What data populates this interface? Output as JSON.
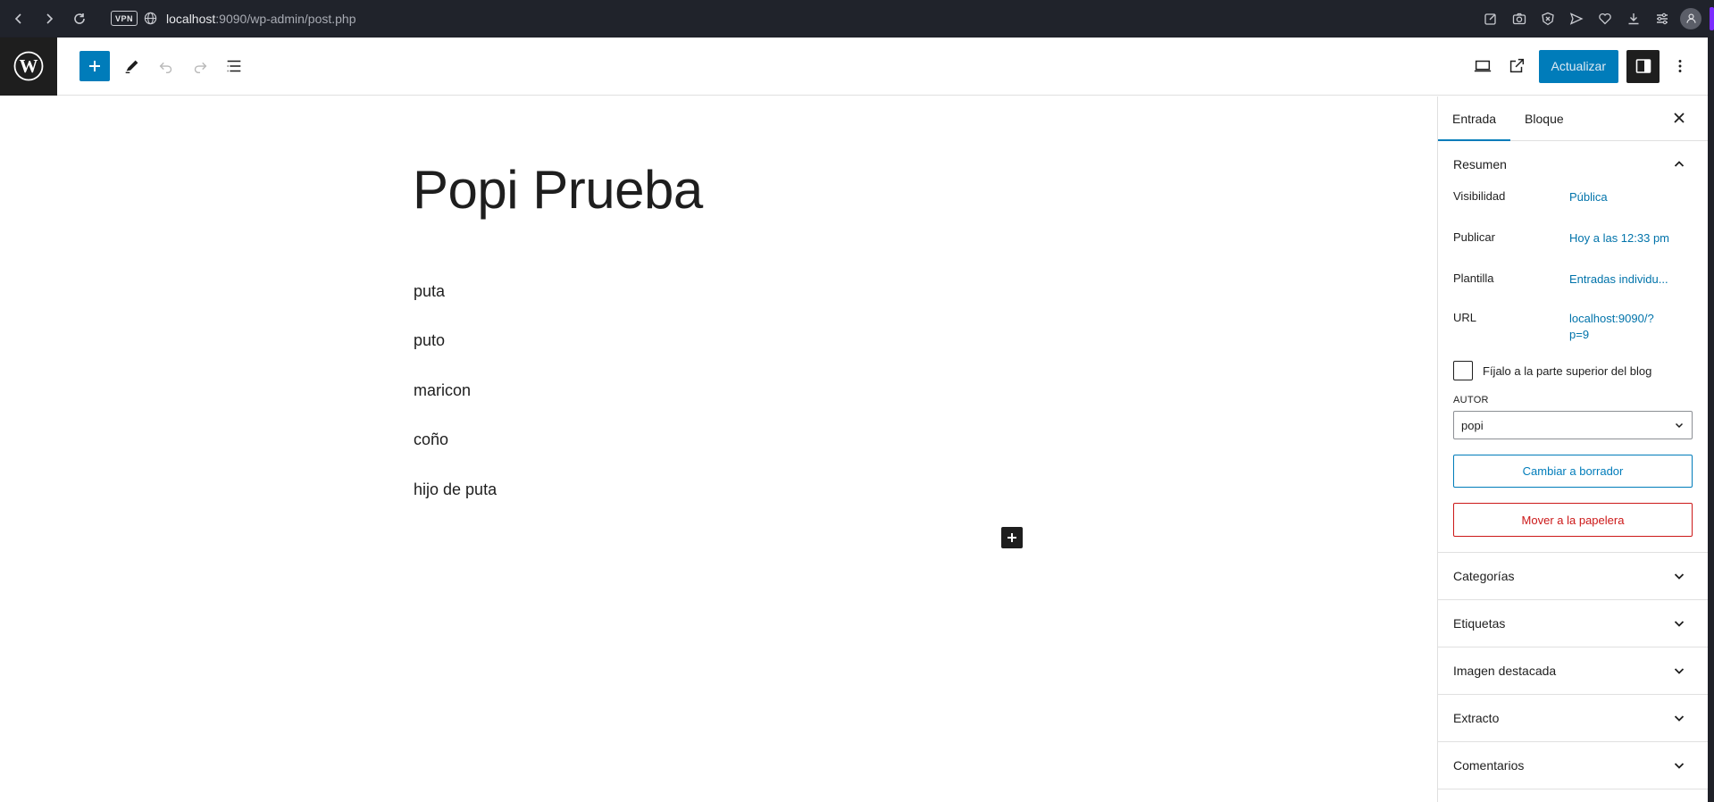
{
  "browser": {
    "vpn_label": "VPN",
    "url_host": "localhost",
    "url_path": ":9090/wp-admin/post.php"
  },
  "toolbar": {
    "update_label": "Actualizar"
  },
  "post": {
    "title": "Popi Prueba",
    "paragraphs": [
      "puta",
      "puto",
      "maricon",
      "coño",
      "hijo de puta"
    ]
  },
  "sidebar": {
    "tabs": [
      "Entrada",
      "Bloque"
    ],
    "summary": {
      "heading": "Resumen",
      "visibility_label": "Visibilidad",
      "visibility_value": "Pública",
      "publish_label": "Publicar",
      "publish_value": "Hoy a las 12:33 pm",
      "template_label": "Plantilla",
      "template_value": "Entradas individu...",
      "url_label": "URL",
      "url_value_line1": "localhost:9090/?",
      "url_value_line2": "p=9",
      "sticky_label": "Fíjalo a la parte superior del blog",
      "author_label": "AUTOR",
      "author_value": "popi",
      "draft_button": "Cambiar a borrador",
      "trash_button": "Mover a la papelera"
    },
    "panels": [
      "Categorías",
      "Etiquetas",
      "Imagen destacada",
      "Extracto",
      "Comentarios"
    ]
  }
}
